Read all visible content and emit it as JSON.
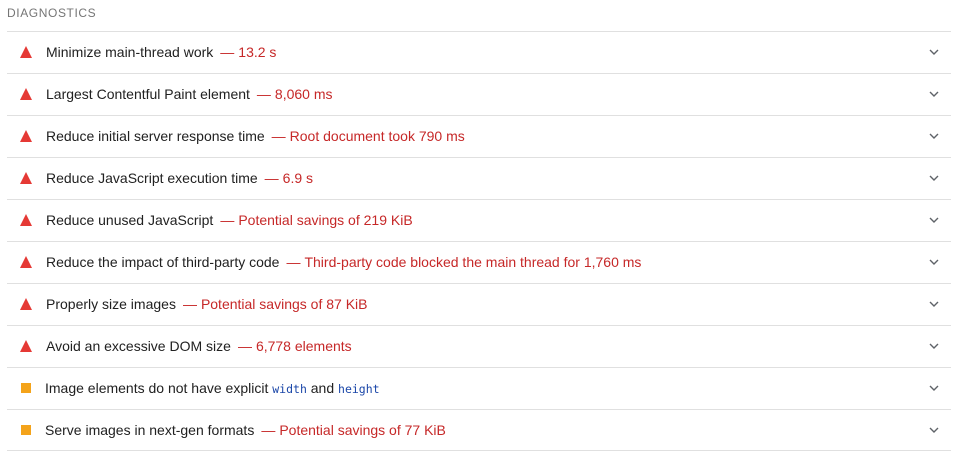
{
  "section": {
    "title": "DIAGNOSTICS"
  },
  "audits": [
    {
      "status": "fail",
      "icon": "red-triangle-fail-icon",
      "title": "Minimize main-thread work",
      "separator": "—",
      "display": "13.2 s"
    },
    {
      "status": "fail",
      "icon": "red-triangle-fail-icon",
      "title": "Largest Contentful Paint element",
      "separator": "—",
      "display": "8,060 ms"
    },
    {
      "status": "fail",
      "icon": "red-triangle-fail-icon",
      "title": "Reduce initial server response time",
      "separator": "—",
      "display": "Root document took 790 ms"
    },
    {
      "status": "fail",
      "icon": "red-triangle-fail-icon",
      "title": "Reduce JavaScript execution time",
      "separator": "—",
      "display": "6.9 s"
    },
    {
      "status": "fail",
      "icon": "red-triangle-fail-icon",
      "title": "Reduce unused JavaScript",
      "separator": "—",
      "display": "Potential savings of 219 KiB"
    },
    {
      "status": "fail",
      "icon": "red-triangle-fail-icon",
      "title": "Reduce the impact of third-party code",
      "separator": "—",
      "display": "Third-party code blocked the main thread for 1,760 ms"
    },
    {
      "status": "fail",
      "icon": "red-triangle-fail-icon",
      "title": "Properly size images",
      "separator": "—",
      "display": "Potential savings of 87 KiB"
    },
    {
      "status": "fail",
      "icon": "red-triangle-fail-icon",
      "title": "Avoid an excessive DOM size",
      "separator": "—",
      "display": "6,778 elements"
    },
    {
      "status": "average",
      "icon": "orange-square-average-icon",
      "title_parts": {
        "before": "Image elements do not have explicit ",
        "code1": "width",
        "middle": " and ",
        "code2": "height"
      }
    },
    {
      "status": "average",
      "icon": "orange-square-average-icon",
      "title": "Serve images in next-gen formats",
      "separator": "—",
      "display": "Potential savings of 77 KiB"
    }
  ],
  "chevron_icon": "chevron-down-icon",
  "colors": {
    "fail": "#e53935",
    "average": "#f4a31a",
    "display_text": "#c62828",
    "code_text": "#1a46a8",
    "divider": "#e0e0e0"
  }
}
